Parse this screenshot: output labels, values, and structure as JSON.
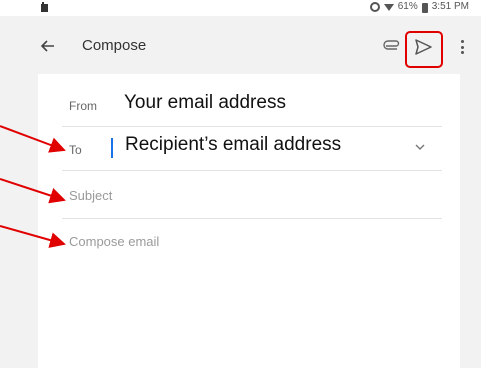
{
  "status_bar": {
    "battery": "61%",
    "time": "3:51 PM"
  },
  "app_bar": {
    "title": "Compose",
    "icons": [
      "back-arrow-icon",
      "paperclip-icon",
      "send-icon",
      "more-vert-icon"
    ],
    "send_highlight_color": "#e00000"
  },
  "form": {
    "from_label": "From",
    "from_value": "Your email address",
    "to_label": "To",
    "to_value": "Recipient’s email address",
    "subject_placeholder": "Subject",
    "body_placeholder": "Compose email"
  },
  "colors": {
    "cursor": "#1a73e8",
    "annotation": "#e00000",
    "appbar_bg": "#f2f2f2"
  }
}
